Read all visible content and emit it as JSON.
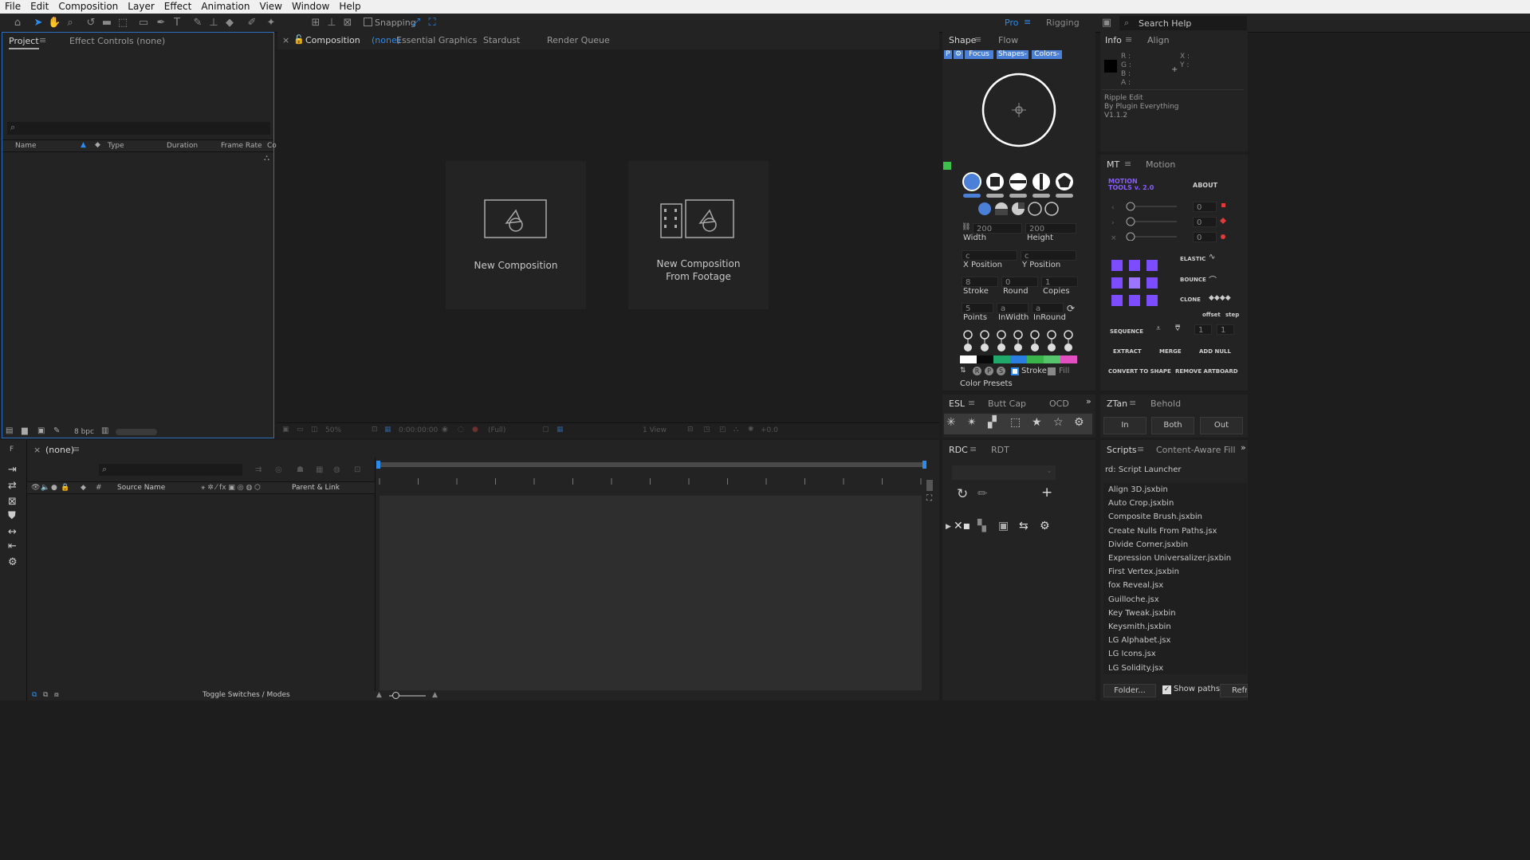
{
  "menubar": {
    "items": [
      "File",
      "Edit",
      "Composition",
      "Layer",
      "Effect",
      "Animation",
      "View",
      "Window",
      "Help"
    ]
  },
  "toolbar": {
    "snapping": "Snapping",
    "workspace_pro": "Pro",
    "workspace_rigging": "Rigging",
    "search_help": "Search Help"
  },
  "project": {
    "tab_project": "Project",
    "tab_effect_controls": "Effect Controls (none)",
    "columns": [
      "Name",
      "Type",
      "Duration",
      "Frame Rate",
      "Co"
    ],
    "bpc": "8 bpc"
  },
  "viewer": {
    "tab_composition": "Composition",
    "tab_composition_suffix": "(none)",
    "tab_essential": "Essential Graphics",
    "tab_stardust": "Stardust",
    "tab_render": "Render Queue",
    "new_comp": "New Composition",
    "new_comp_footage_1": "New Composition",
    "new_comp_footage_2": "From Footage",
    "zoom": "50%",
    "timecode": "0:00:00:00",
    "resolution": "(Full)",
    "views": "1 View",
    "exposure": "+0.0"
  },
  "shape_panel": {
    "tab_shape": "Shape",
    "tab_flow": "Flow",
    "p_label": "P",
    "focus": "Focus",
    "shapes": "Shapes-",
    "colors": "Colors-",
    "width_val": "200",
    "height_val": "200",
    "width": "Width",
    "height": "Height",
    "xpos_val": "c",
    "ypos_val": "c",
    "xpos": "X Position",
    "ypos": "Y Position",
    "stroke_val": "8",
    "round_val": "0",
    "copies_val": "1",
    "stroke": "Stroke",
    "round": "Round",
    "copies": "Copies",
    "points_val": "5",
    "inwidth_val": "a",
    "inround_val": "a",
    "points": "Points",
    "inwidth": "InWidth",
    "inround": "InRound",
    "stroke_toggle": "Stroke",
    "fill_toggle": "Fill",
    "rps": [
      "R",
      "P",
      "S"
    ],
    "color_presets": "Color Presets",
    "swatches": [
      "#ffffff",
      "#0a0a0a",
      "#1fa86a",
      "#2a7de1",
      "#3ab34a",
      "#55c46c",
      "#e24fc0"
    ]
  },
  "info_panel": {
    "tab_info": "Info",
    "tab_align": "Align",
    "r": "R :",
    "g": "G :",
    "b": "B :",
    "a": "A :",
    "x": "X :",
    "y": "Y :",
    "ripple_1": "Ripple Edit",
    "ripple_2": "By Plugin Everything",
    "ripple_3": "V1.1.2"
  },
  "motion_panel": {
    "tab_mt": "MT",
    "tab_motion": "Motion",
    "logo_1": "MOTION",
    "logo_2": "TOOLS v. 2.0",
    "about": "ABOUT",
    "slider_vals": [
      "0",
      "0",
      "0"
    ],
    "elastic": "ELASTIC",
    "bounce": "BOUNCE",
    "clone": "CLONE",
    "offset": "offset",
    "step": "step",
    "sequence": "SEQUENCE",
    "seq_vals": [
      "1",
      "1"
    ],
    "extract": "EXTRACT",
    "merge": "MERGE",
    "add_null": "ADD NULL",
    "convert": "CONVERT TO SHAPE",
    "remove_artboard": "REMOVE ARTBOARD"
  },
  "esl_panel": {
    "tab_esl": "ESL",
    "tab_buttcap": "Butt Cap",
    "tab_ocd": "OCD"
  },
  "ztan_panel": {
    "tab_ztan": "ZTan",
    "tab_behold": "Behold",
    "in": "In",
    "both": "Both",
    "out": "Out"
  },
  "rdc_panel": {
    "tab_rdc": "RDC",
    "tab_rdt": "RDT"
  },
  "scripts_panel": {
    "tab_scripts": "Scripts",
    "tab_caf": "Content-Aware Fill",
    "launcher": "rd: Script Launcher",
    "items": [
      "Align 3D.jsxbin",
      "Auto Crop.jsxbin",
      "Composite Brush.jsxbin",
      "Create Nulls From Paths.jsx",
      "Divide Corner.jsxbin",
      "Expression Universalizer.jsxbin",
      "First Vertex.jsxbin",
      "fox Reveal.jsx",
      "Guilloche.jsx",
      "Key Tweak.jsxbin",
      "Keysmith.jsxbin",
      "LG Alphabet.jsx",
      "LG Icons.jsx",
      "LG Solidity.jsx"
    ],
    "folder": "Folder...",
    "show_paths": "Show paths",
    "refresh": "Refre"
  },
  "timeline": {
    "tab": "(none)",
    "source_name": "Source Name",
    "parent_link": "Parent & Link",
    "toggle": "Toggle Switches / Modes",
    "f_label": "F"
  },
  "colors": {
    "accent": "#2d8ceb",
    "selection": "#4a80d8",
    "purple": "#7b4dff"
  }
}
